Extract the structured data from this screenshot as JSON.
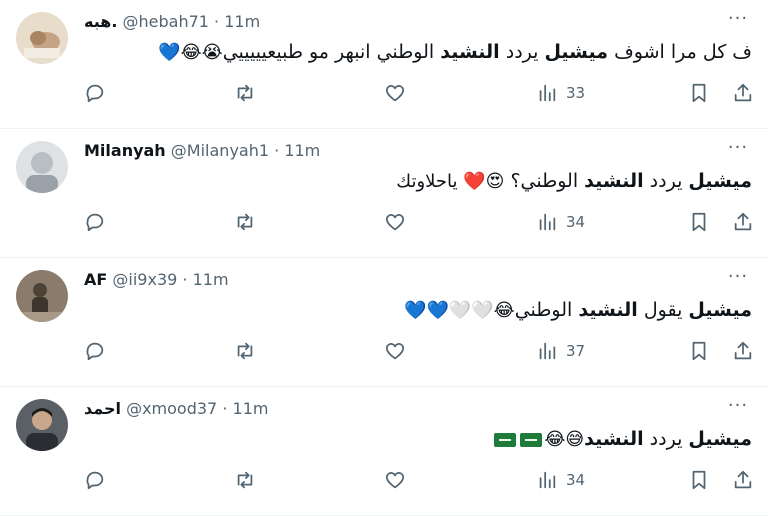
{
  "tweets": [
    {
      "name": "هبه.",
      "handle": "@hebah71",
      "sep": "·",
      "time": "11m",
      "more": "···",
      "body_pre": "ف كل مرا اشوف ",
      "body_bold1": "ميشيل",
      "body_mid": " يردد ",
      "body_bold2": "النشيد",
      "body_post": " الوطني انبهر مو طبيعيييييي",
      "emojis": "😭😂💙",
      "replies": "",
      "retweets": "",
      "likes": "",
      "views": "33",
      "avatar_color": "#c4a484"
    },
    {
      "name": "Milanyah",
      "handle": "@Milanyah1",
      "sep": "·",
      "time": "11m",
      "more": "···",
      "body_pre": "",
      "body_bold1": "ميشيل",
      "body_mid": " يردد ",
      "body_bold2": "النشيد",
      "body_post": " الوطني؟ ",
      "emojis": "😍❤️ ياحلاوتك",
      "replies": "",
      "retweets": "",
      "likes": "",
      "views": "34",
      "avatar_color": "#b9bec4"
    },
    {
      "name": "AF",
      "handle": "@ii9x39",
      "sep": "·",
      "time": "11m",
      "more": "···",
      "body_pre": "",
      "body_bold1": "ميشيل",
      "body_mid": " يقول ",
      "body_bold2": "النشيد",
      "body_post": " الوطني",
      "emojis": "😂🤍🤍💙💙",
      "replies": "",
      "retweets": "",
      "likes": "",
      "views": "37",
      "avatar_color": "#6b5d4f"
    },
    {
      "name": "احمد",
      "handle": "@xmood37",
      "sep": "·",
      "time": "11m",
      "more": "···",
      "body_pre": "",
      "body_bold1": "ميشيل",
      "body_mid": " يردد ",
      "body_bold2": "النشيد",
      "body_post": "",
      "emojis": "😅😂",
      "replies": "",
      "retweets": "",
      "likes": "",
      "views": "34",
      "avatar_color": "#3a3f44"
    }
  ],
  "colors": {
    "text": "#0f1419",
    "secondary": "#536471",
    "divider": "#eff3f4",
    "flag_green": "#1e7b3a"
  },
  "icons": [
    "reply-icon",
    "retweet-icon",
    "like-icon",
    "views-icon",
    "bookmark-icon",
    "share-icon",
    "more-icon"
  ]
}
